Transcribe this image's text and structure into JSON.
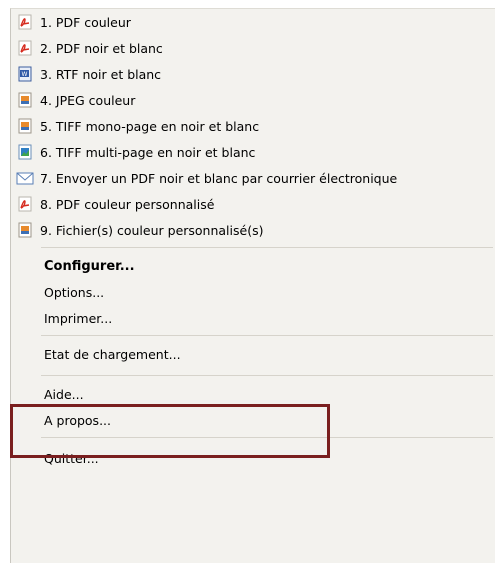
{
  "menu": {
    "items": [
      {
        "label": "1. PDF couleur",
        "icon": "pdf-icon"
      },
      {
        "label": "2. PDF noir et blanc",
        "icon": "pdf-icon"
      },
      {
        "label": "3. RTF noir et blanc",
        "icon": "word-document-icon"
      },
      {
        "label": "4. JPEG couleur",
        "icon": "image-icon"
      },
      {
        "label": "5. TIFF mono-page en noir et blanc",
        "icon": "image-icon"
      },
      {
        "label": "6. TIFF multi-page en noir et blanc",
        "icon": "image-multipage-icon"
      },
      {
        "label": "7. Envoyer un PDF noir et blanc par courrier électronique",
        "icon": "email-icon"
      },
      {
        "label": "8. PDF couleur personnalisé",
        "icon": "pdf-icon"
      },
      {
        "label": "9. Fichier(s) couleur personnalisé(s)",
        "icon": "image-icon"
      }
    ],
    "configurer": "Configurer...",
    "options": "Options...",
    "imprimer": "Imprimer...",
    "etat_chargement": "Etat de chargement...",
    "aide": "Aide...",
    "a_propos": "A propos...",
    "quitter": "Quitter..."
  },
  "colors": {
    "menu_bg": "#f3f2ee",
    "highlight_border": "#7a1f1f",
    "pdf_red": "#d62b1f"
  }
}
